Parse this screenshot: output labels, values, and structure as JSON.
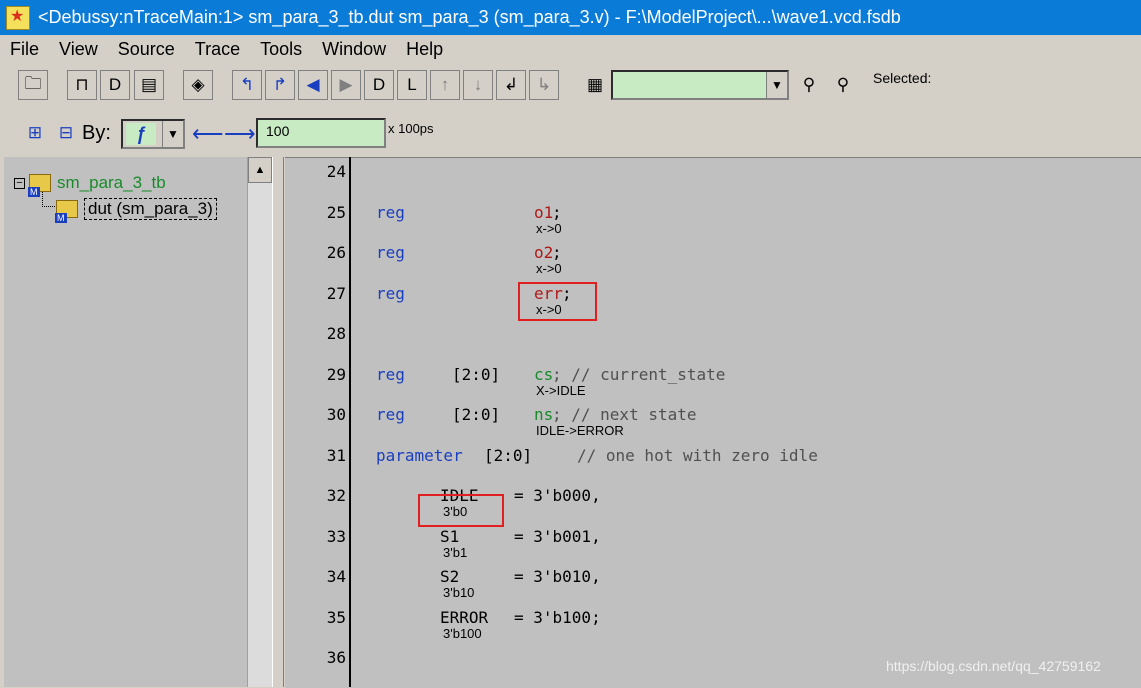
{
  "window": {
    "title": "<Debussy:nTraceMain:1> sm_para_3_tb.dut sm_para_3 (sm_para_3.v) - F:\\ModelProject\\...\\wave1.vcd.fsdb"
  },
  "menu": [
    "File",
    "View",
    "Source",
    "Trace",
    "Tools",
    "Window",
    "Help"
  ],
  "toolbar": {
    "selected_label": "Selected:",
    "signal_combo_value": ""
  },
  "toolbar2": {
    "by_label": "By:",
    "step_value": "100",
    "step_unit": "x 100ps"
  },
  "hierarchy": {
    "root": "sm_para_3_tb",
    "child": "dut (sm_para_3)"
  },
  "lines": [
    {
      "no": "24"
    },
    {
      "no": "25",
      "kw": "reg",
      "range": "",
      "sig": "o1",
      "rest": ";",
      "ann": "x->0"
    },
    {
      "no": "26",
      "kw": "reg",
      "range": "",
      "sig": "o2",
      "rest": ";",
      "ann": "x->0"
    },
    {
      "no": "27",
      "kw": "reg",
      "range": "",
      "sig": "err",
      "rest": ";",
      "ann": "x->0"
    },
    {
      "no": "28"
    },
    {
      "no": "29",
      "kw": "reg",
      "range": "[2:0]",
      "sig": "cs",
      "rest": "; // current_state",
      "ann": "X->IDLE"
    },
    {
      "no": "30",
      "kw": "reg",
      "range": "[2:0]",
      "sig": "ns",
      "rest": "; // next state",
      "ann": "IDLE->ERROR"
    },
    {
      "no": "31",
      "kw": "parameter",
      "range": "[2:0]",
      "comment": "// one hot with zero idle"
    },
    {
      "no": "32",
      "param": "IDLE",
      "val": "= 3'b000,",
      "ann": "3'b0"
    },
    {
      "no": "33",
      "param": "S1",
      "val": "= 3'b001,",
      "ann": "3'b1"
    },
    {
      "no": "34",
      "param": "S2",
      "val": "= 3'b010,",
      "ann": "3'b10"
    },
    {
      "no": "35",
      "param": "ERROR",
      "val": "= 3'b100;",
      "ann": "3'b100"
    },
    {
      "no": "36"
    }
  ],
  "watermark": "https://blog.csdn.net/qq_42759162"
}
